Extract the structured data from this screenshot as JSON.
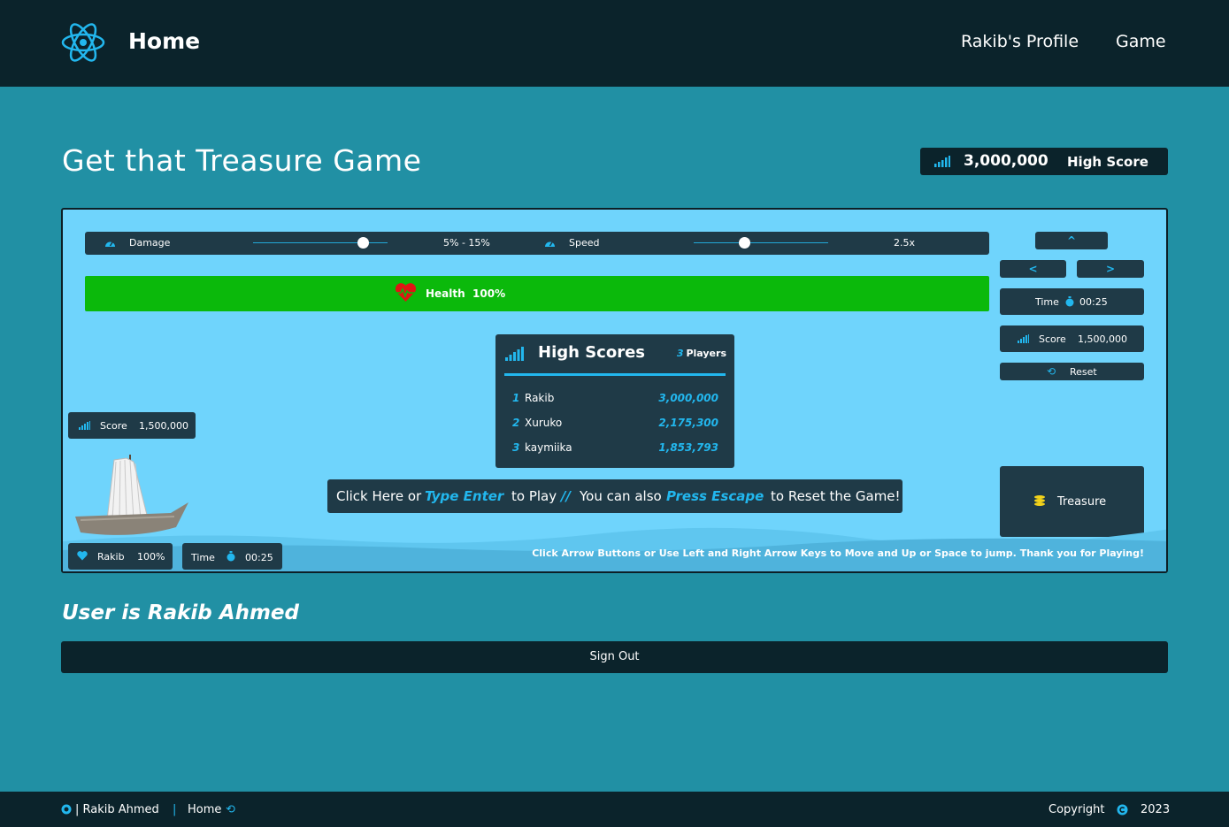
{
  "nav": {
    "brand": "Home",
    "links": [
      "Rakib's Profile",
      "Game"
    ]
  },
  "page": {
    "title": "Get that Treasure Game",
    "high_score_value": "3,000,000",
    "high_score_label": "High Score"
  },
  "controls": {
    "damage_label": "Damage",
    "damage_value": "5% - 15%",
    "speed_label": "Speed",
    "speed_value": "2.5x"
  },
  "health": {
    "label": "Health",
    "value": "100%"
  },
  "buttons": {
    "up": "^",
    "left": "<",
    "right": ">",
    "reset": "Reset",
    "treasure": "Treasure"
  },
  "right_panel": {
    "time_label": "Time",
    "time_value": "00:25",
    "score_label": "Score",
    "score_value": "1,500,000"
  },
  "high_scores": {
    "title": "High Scores",
    "player_count": "3",
    "players_label": "Players",
    "rows": [
      {
        "rank": "1",
        "name": "Rakib",
        "score": "3,000,000"
      },
      {
        "rank": "2",
        "name": "Xuruko",
        "score": "2,175,300"
      },
      {
        "rank": "3",
        "name": "kaymiika",
        "score": "1,853,793"
      }
    ]
  },
  "play_msg": {
    "p1": "Click Here or",
    "h1": "Type Enter",
    "p2": "to Play",
    "sep": "//",
    "p3": "You can also",
    "h2": "Press Escape",
    "p4": "to Reset the Game!"
  },
  "left_panel": {
    "score_label": "Score",
    "score_value": "1,500,000",
    "player_name": "Rakib",
    "player_health": "100%",
    "time_label": "Time",
    "time_value": "00:25"
  },
  "help_text": "Click Arrow Buttons or Use Left and Right Arrow Keys to Move and Up or Space to jump. Thank you for Playing!",
  "user_text": "User is Rakib Ahmed",
  "sign_out": "Sign Out",
  "footer": {
    "author": "| Rakib Ahmed",
    "sep": "|",
    "home": "Home",
    "copyright": "Copyright",
    "year": "2023"
  },
  "sliders": {
    "damage_level": 0.82,
    "speed_level": 0.38
  },
  "colors": {
    "accent": "#22b7ee",
    "nav_bg": "#0b232b",
    "page_bg": "#2190a4",
    "game_bg": "#6fd4fc",
    "health": "#0bb90b"
  }
}
